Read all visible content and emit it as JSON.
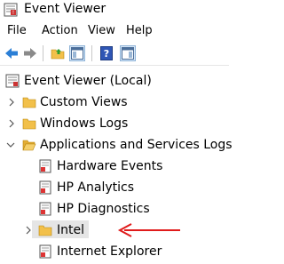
{
  "window": {
    "title": "Event Viewer"
  },
  "menu": {
    "items": [
      "File",
      "Action",
      "View",
      "Help"
    ]
  },
  "toolbar": {
    "buttons": [
      "back-icon",
      "forward-icon",
      "up-folder-icon",
      "show-hide-tree-icon",
      "help-icon",
      "properties-pane-icon"
    ]
  },
  "tree": {
    "root": "Event Viewer (Local)",
    "custom_views": "Custom Views",
    "windows_logs": "Windows Logs",
    "apps_services": "Applications and Services Logs",
    "hardware_events": "Hardware Events",
    "hp_analytics": "HP Analytics",
    "hp_diagnostics": "HP Diagnostics",
    "intel": "Intel",
    "internet_explorer": "Internet Explorer"
  },
  "colors": {
    "folder": "#f2c04a",
    "log_icon": "#d33",
    "arrow": "#e01b1b",
    "selection": "#e5e5e5"
  }
}
